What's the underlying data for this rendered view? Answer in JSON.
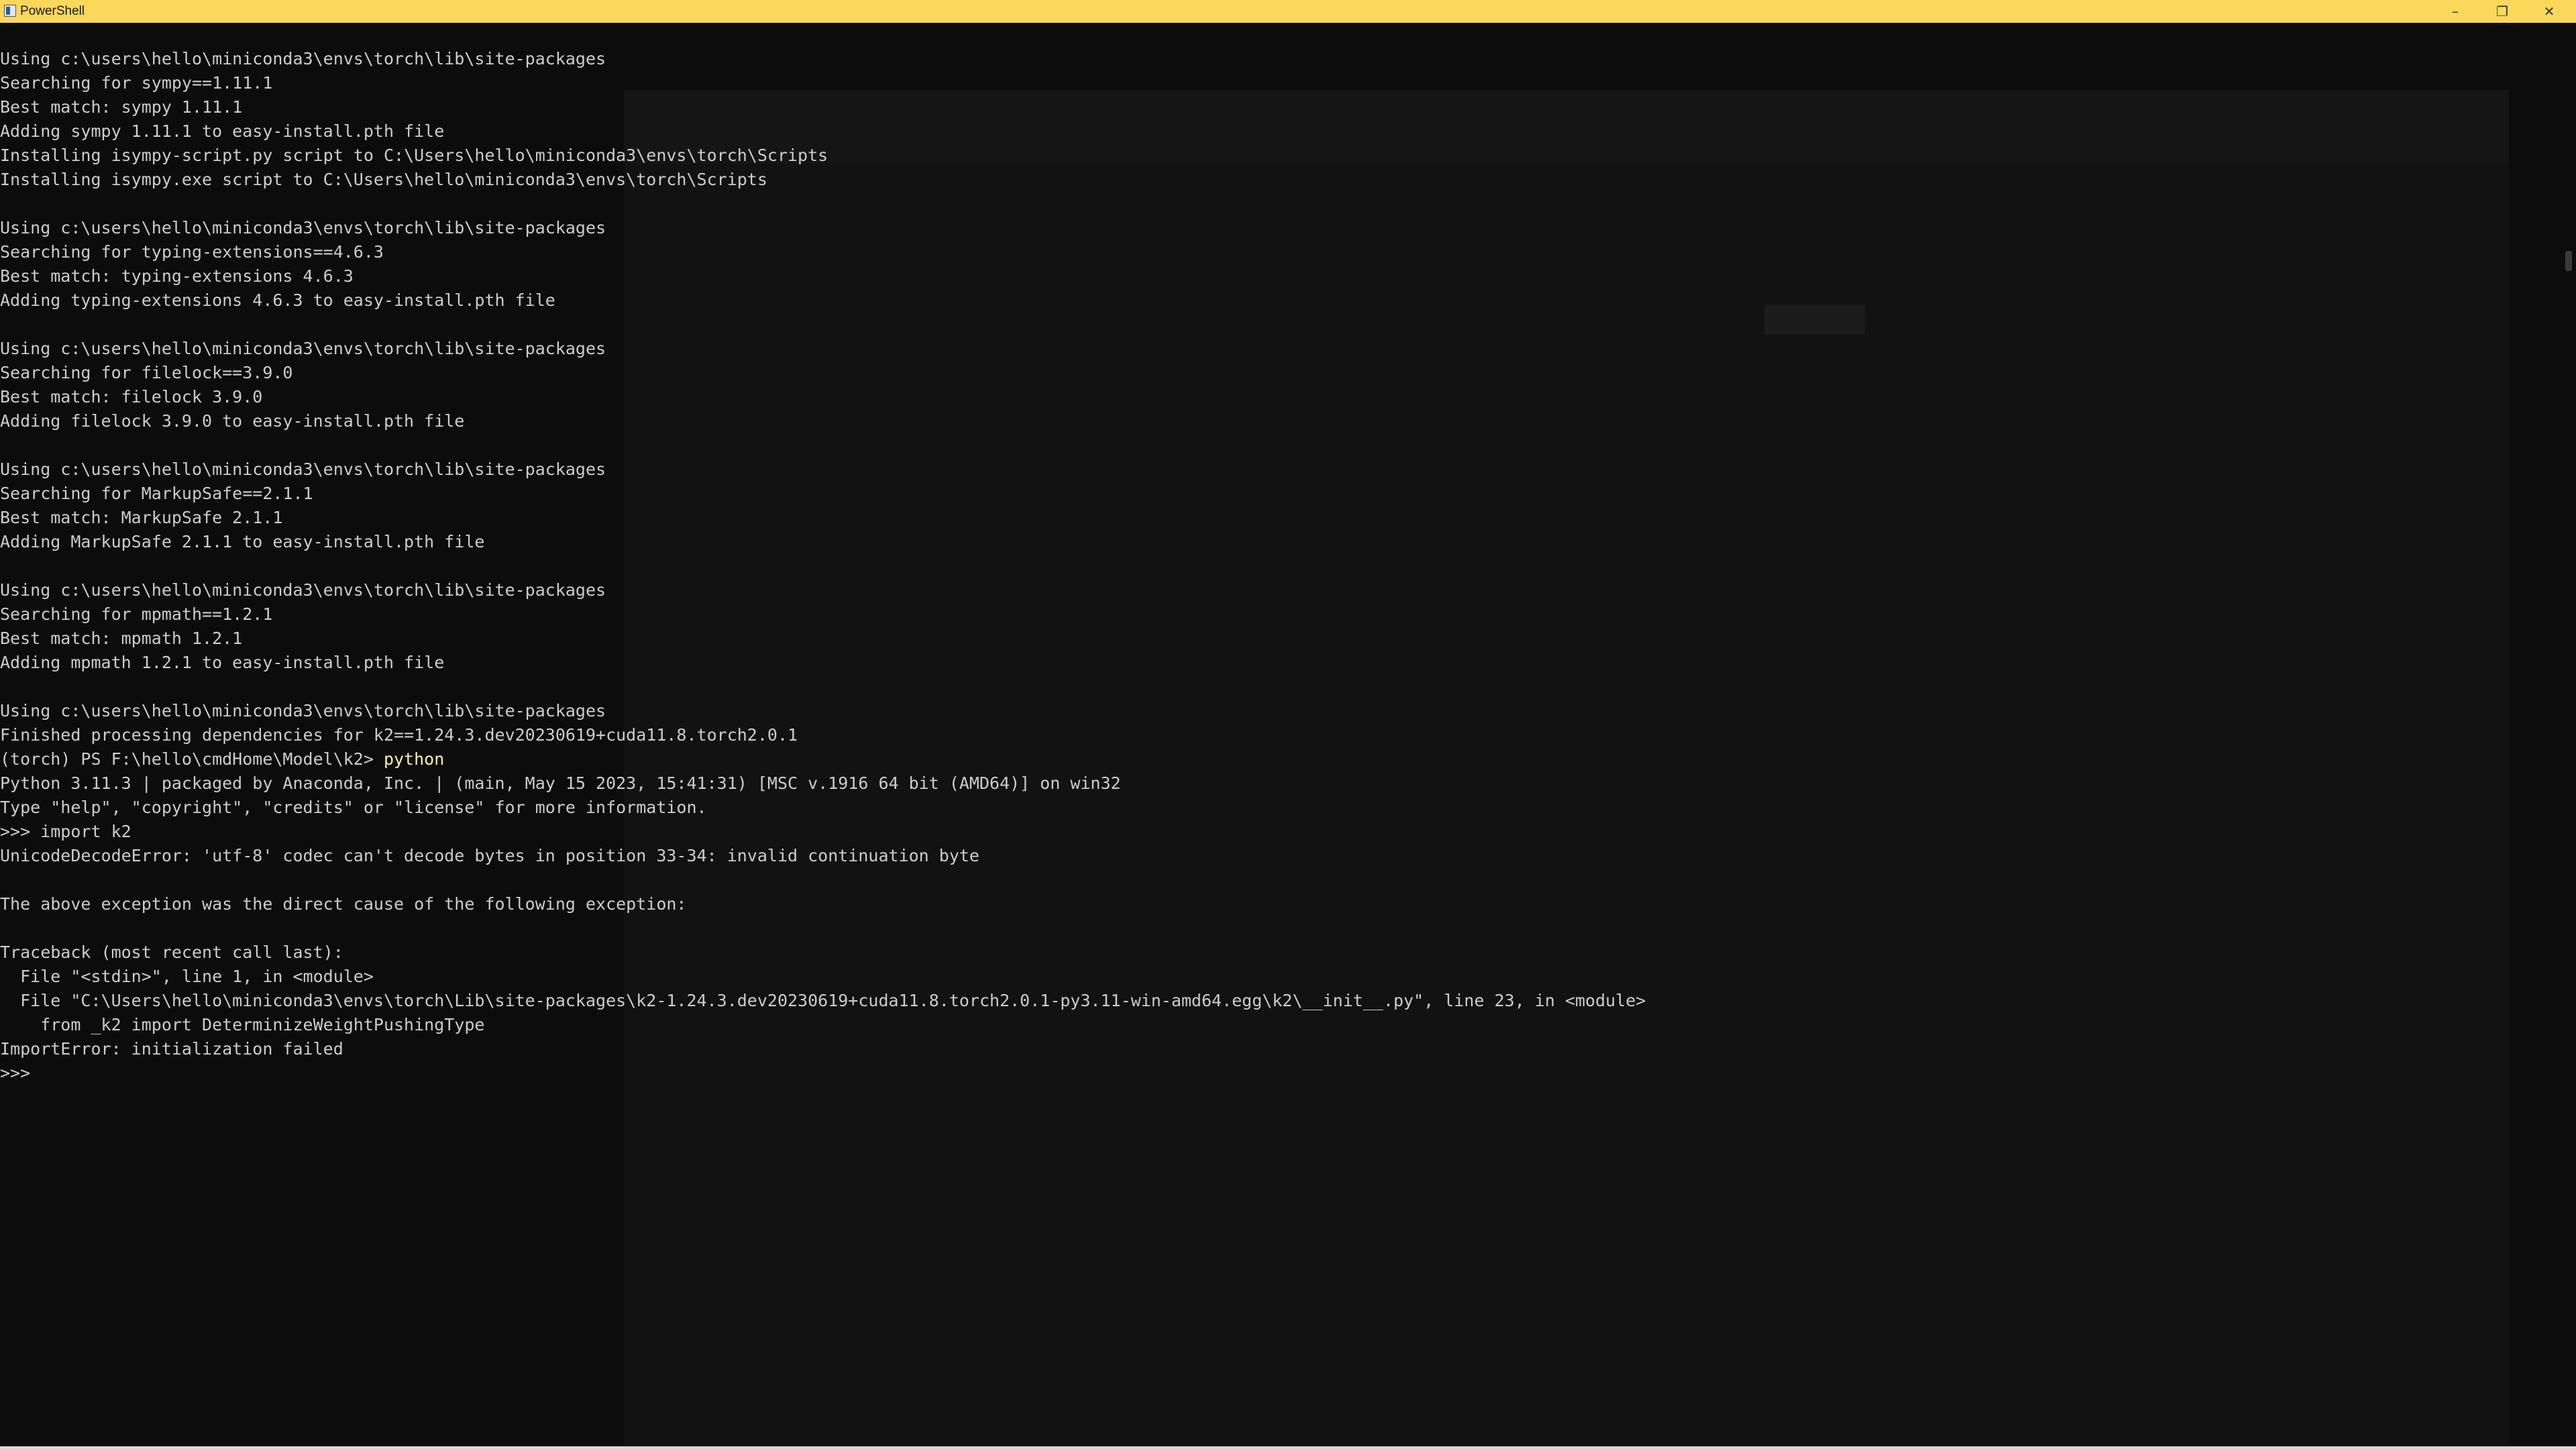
{
  "window": {
    "title": "PowerShell",
    "controls": {
      "minimize": "–",
      "maximize": "❐",
      "close": "✕"
    },
    "colors": {
      "titlebar": "#fbd85a",
      "background": "#0c0c0c",
      "text": "#cccccc",
      "command": "#f9f1a5"
    }
  },
  "terminal": {
    "lines": [
      "Using c:\\users\\hello\\miniconda3\\envs\\torch\\lib\\site-packages",
      "Searching for sympy==1.11.1",
      "Best match: sympy 1.11.1",
      "Adding sympy 1.11.1 to easy-install.pth file",
      "Installing isympy-script.py script to C:\\Users\\hello\\miniconda3\\envs\\torch\\Scripts",
      "Installing isympy.exe script to C:\\Users\\hello\\miniconda3\\envs\\torch\\Scripts",
      "",
      "Using c:\\users\\hello\\miniconda3\\envs\\torch\\lib\\site-packages",
      "Searching for typing-extensions==4.6.3",
      "Best match: typing-extensions 4.6.3",
      "Adding typing-extensions 4.6.3 to easy-install.pth file",
      "",
      "Using c:\\users\\hello\\miniconda3\\envs\\torch\\lib\\site-packages",
      "Searching for filelock==3.9.0",
      "Best match: filelock 3.9.0",
      "Adding filelock 3.9.0 to easy-install.pth file",
      "",
      "Using c:\\users\\hello\\miniconda3\\envs\\torch\\lib\\site-packages",
      "Searching for MarkupSafe==2.1.1",
      "Best match: MarkupSafe 2.1.1",
      "Adding MarkupSafe 2.1.1 to easy-install.pth file",
      "",
      "Using c:\\users\\hello\\miniconda3\\envs\\torch\\lib\\site-packages",
      "Searching for mpmath==1.2.1",
      "Best match: mpmath 1.2.1",
      "Adding mpmath 1.2.1 to easy-install.pth file",
      "",
      "Using c:\\users\\hello\\miniconda3\\envs\\torch\\lib\\site-packages",
      "Finished processing dependencies for k2==1.24.3.dev20230619+cuda11.8.torch2.0.1"
    ],
    "prompt": "(torch) PS F:\\hello\\cmdHome\\Model\\k2> ",
    "prompt_command": "python",
    "session_lines": [
      "Python 3.11.3 | packaged by Anaconda, Inc. | (main, May 15 2023, 15:41:31) [MSC v.1916 64 bit (AMD64)] on win32",
      "Type \"help\", \"copyright\", \"credits\" or \"license\" for more information.",
      ">>> import k2",
      "UnicodeDecodeError: 'utf-8' codec can't decode bytes in position 33-34: invalid continuation byte",
      "",
      "The above exception was the direct cause of the following exception:",
      "",
      "Traceback (most recent call last):",
      "  File \"<stdin>\", line 1, in <module>",
      "  File \"C:\\Users\\hello\\miniconda3\\envs\\torch\\Lib\\site-packages\\k2-1.24.3.dev20230619+cuda11.8.torch2.0.1-py3.11-win-amd64.egg\\k2\\__init__.py\", line 23, in <module>",
      "    from _k2 import DeterminizeWeightPushingType",
      "ImportError: initialization failed",
      ">>> "
    ]
  }
}
